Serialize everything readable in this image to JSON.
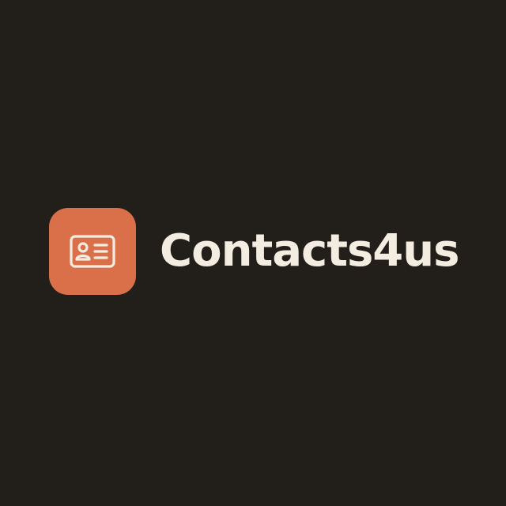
{
  "brand": {
    "name": "Contacts4us",
    "icon": "contact-card-icon"
  },
  "colors": {
    "background": "#221e1a",
    "icon_tile": "#d9704a",
    "icon_glyph": "#f3ece1",
    "text": "#f3ece1"
  }
}
